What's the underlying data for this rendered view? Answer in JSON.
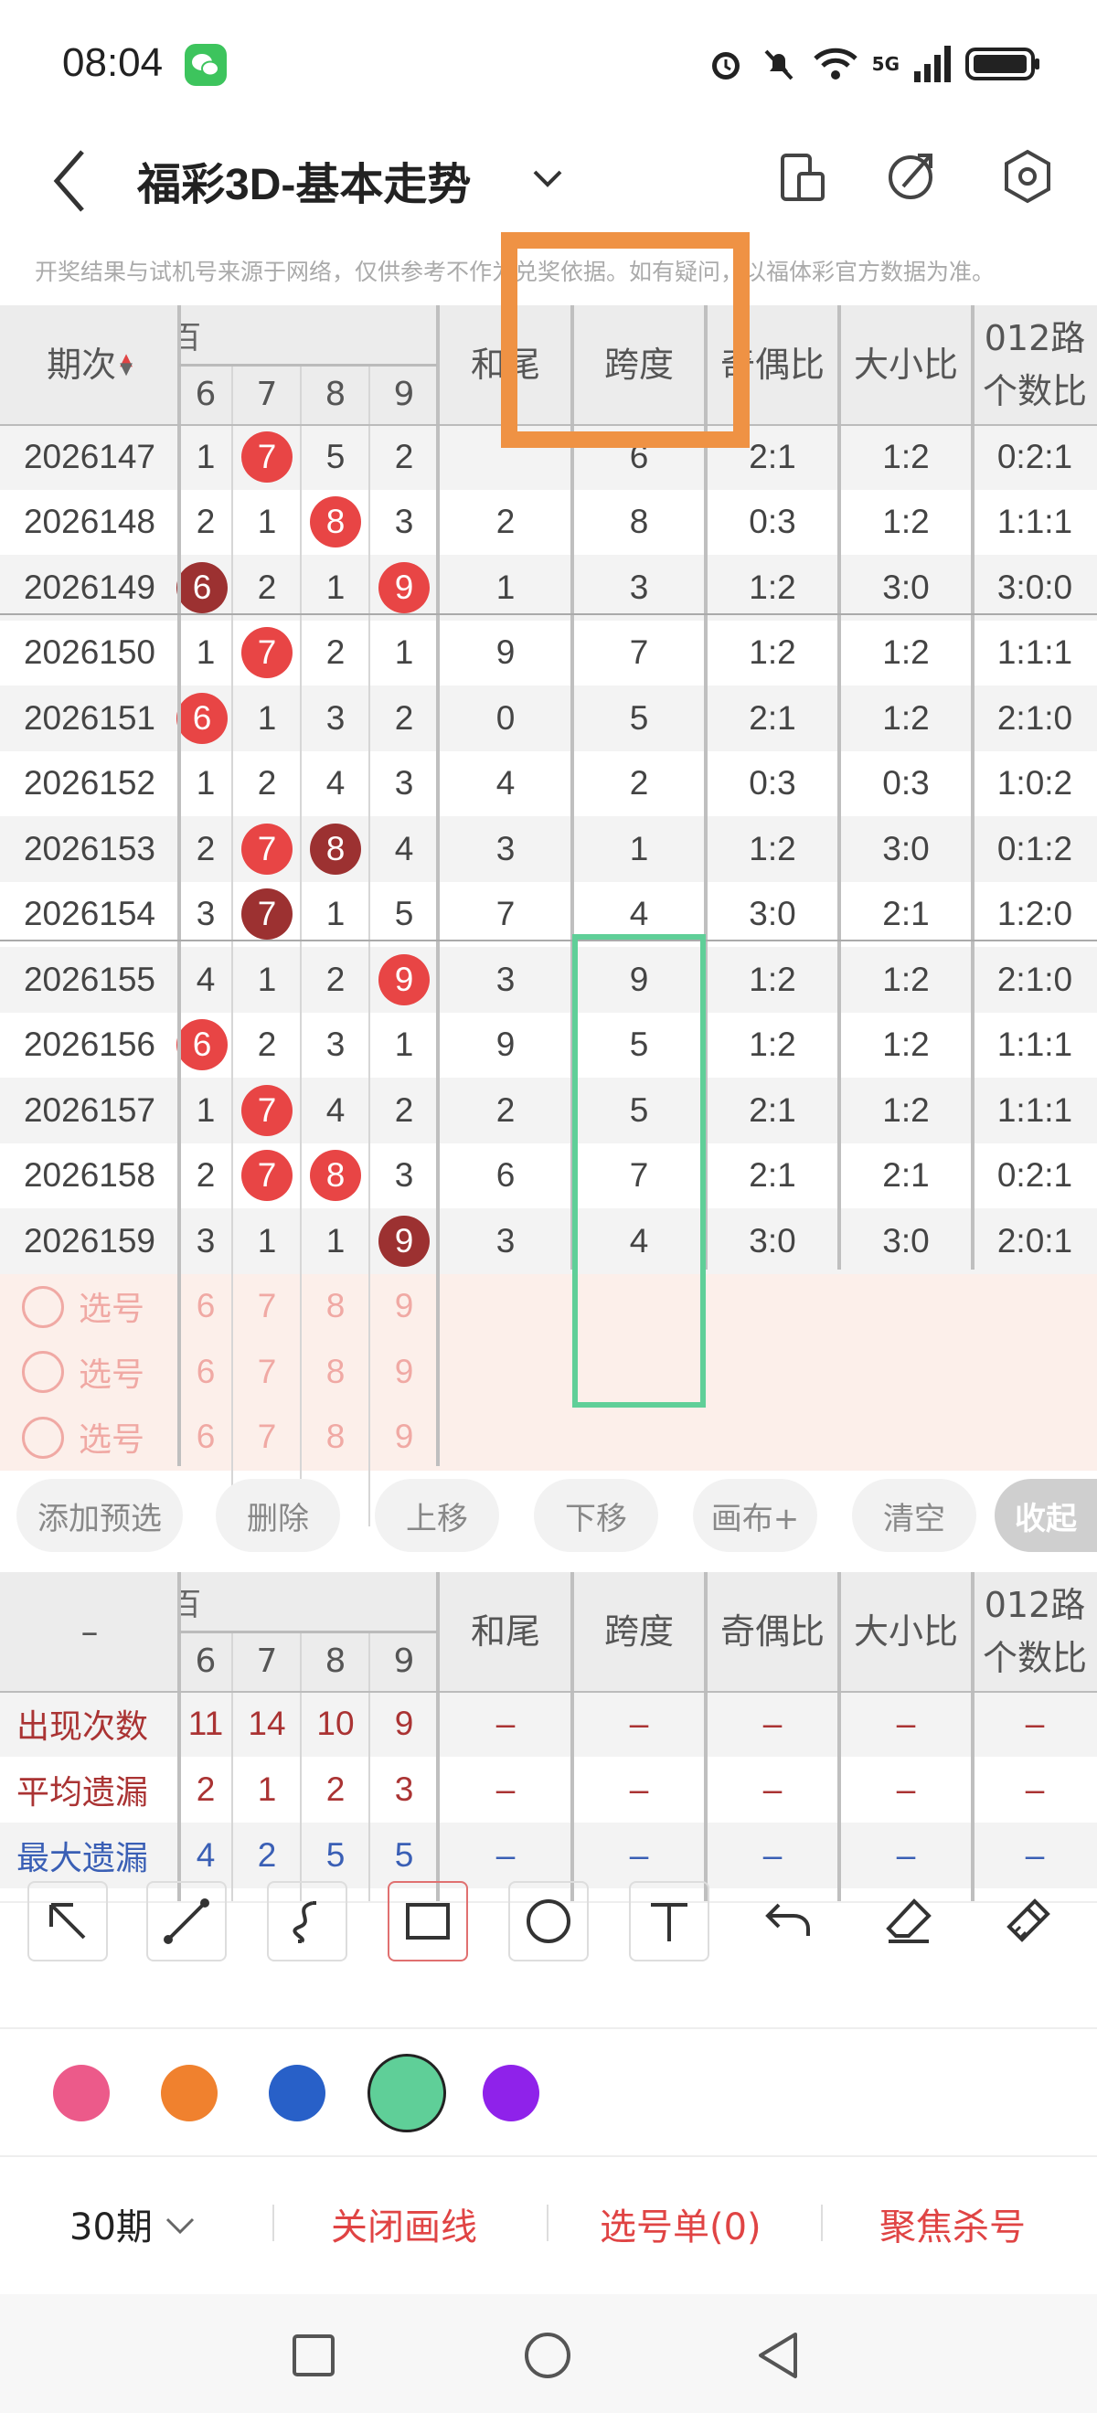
{
  "status_bar": {
    "time": "08:04",
    "network": "5G"
  },
  "header": {
    "title": "福彩3D-基本走势"
  },
  "notice": "开奖结果与试机号来源于网络，仅供参考不作为兑奖依据。如有疑问，以福体彩官方数据为准。",
  "table": {
    "headers": {
      "period": "期次",
      "digit_group": "百",
      "digits": [
        "6",
        "7",
        "8",
        "9"
      ],
      "hewei": "和尾",
      "kuadu": "跨度",
      "jiou": "奇偶比",
      "daxiao": "大小比",
      "lu012": "012路个数比"
    },
    "rows": [
      {
        "period": "2026147",
        "d": [
          "1",
          "7",
          "5",
          "2"
        ],
        "balls": [
          "",
          "red",
          "",
          ""
        ],
        "hewei": "",
        "kuadu": "6",
        "jiou": "2:1",
        "daxiao": "1:2",
        "lu": "0:2:1"
      },
      {
        "period": "2026148",
        "d": [
          "2",
          "1",
          "8",
          "3"
        ],
        "balls": [
          "",
          "",
          "red",
          ""
        ],
        "hewei": "2",
        "kuadu": "8",
        "jiou": "0:3",
        "daxiao": "1:2",
        "lu": "1:1:1"
      },
      {
        "period": "2026149",
        "d": [
          "6",
          "2",
          "1",
          "9"
        ],
        "balls": [
          "dark",
          "",
          "",
          "red"
        ],
        "hewei": "1",
        "kuadu": "3",
        "jiou": "1:2",
        "daxiao": "3:0",
        "lu": "3:0:0"
      },
      {
        "period": "2026150",
        "d": [
          "1",
          "7",
          "2",
          "1"
        ],
        "balls": [
          "",
          "red",
          "",
          ""
        ],
        "hewei": "9",
        "kuadu": "7",
        "jiou": "1:2",
        "daxiao": "1:2",
        "lu": "1:1:1"
      },
      {
        "period": "2026151",
        "d": [
          "6",
          "1",
          "3",
          "2"
        ],
        "balls": [
          "red",
          "",
          "",
          ""
        ],
        "hewei": "0",
        "kuadu": "5",
        "jiou": "2:1",
        "daxiao": "1:2",
        "lu": "2:1:0"
      },
      {
        "period": "2026152",
        "d": [
          "1",
          "2",
          "4",
          "3"
        ],
        "balls": [
          "",
          "",
          "",
          ""
        ],
        "hewei": "4",
        "kuadu": "2",
        "jiou": "0:3",
        "daxiao": "0:3",
        "lu": "1:0:2"
      },
      {
        "period": "2026153",
        "d": [
          "2",
          "7",
          "8",
          "4"
        ],
        "balls": [
          "",
          "red",
          "dark",
          ""
        ],
        "hewei": "3",
        "kuadu": "1",
        "jiou": "1:2",
        "daxiao": "3:0",
        "lu": "0:1:2"
      },
      {
        "period": "2026154",
        "d": [
          "3",
          "7",
          "1",
          "5"
        ],
        "balls": [
          "",
          "dark",
          "",
          ""
        ],
        "hewei": "7",
        "kuadu": "4",
        "jiou": "3:0",
        "daxiao": "2:1",
        "lu": "1:2:0"
      },
      {
        "period": "2026155",
        "d": [
          "4",
          "1",
          "2",
          "9"
        ],
        "balls": [
          "",
          "",
          "",
          "red"
        ],
        "hewei": "3",
        "kuadu": "9",
        "jiou": "1:2",
        "daxiao": "1:2",
        "lu": "2:1:0"
      },
      {
        "period": "2026156",
        "d": [
          "6",
          "2",
          "3",
          "1"
        ],
        "balls": [
          "red",
          "",
          "",
          ""
        ],
        "hewei": "9",
        "kuadu": "5",
        "jiou": "1:2",
        "daxiao": "1:2",
        "lu": "1:1:1"
      },
      {
        "period": "2026157",
        "d": [
          "1",
          "7",
          "4",
          "2"
        ],
        "balls": [
          "",
          "red",
          "",
          ""
        ],
        "hewei": "2",
        "kuadu": "5",
        "jiou": "2:1",
        "daxiao": "1:2",
        "lu": "1:1:1"
      },
      {
        "period": "2026158",
        "d": [
          "2",
          "7",
          "8",
          "3"
        ],
        "balls": [
          "",
          "red",
          "red",
          ""
        ],
        "hewei": "6",
        "kuadu": "7",
        "jiou": "2:1",
        "daxiao": "2:1",
        "lu": "0:2:1"
      },
      {
        "period": "2026159",
        "d": [
          "3",
          "1",
          "1",
          "9"
        ],
        "balls": [
          "",
          "",
          "",
          "dark"
        ],
        "hewei": "3",
        "kuadu": "4",
        "jiou": "3:0",
        "daxiao": "3:0",
        "lu": "2:0:1"
      }
    ],
    "pick_rows": [
      {
        "label": "选号",
        "digits": [
          "6",
          "7",
          "8",
          "9"
        ]
      },
      {
        "label": "选号",
        "digits": [
          "6",
          "7",
          "8",
          "9"
        ]
      },
      {
        "label": "选号",
        "digits": [
          "6",
          "7",
          "8",
          "9"
        ]
      }
    ]
  },
  "actions": {
    "add_pre": "添加预选",
    "delete": "删除",
    "move_up": "上移",
    "move_down": "下移",
    "canvas_plus": "画布+",
    "clear": "清空",
    "collapse": "收起"
  },
  "stats": {
    "header_dash": "–",
    "rows": [
      {
        "label": "出现次数",
        "values": [
          "11",
          "14",
          "10",
          "9"
        ],
        "rest": [
          "–",
          "–",
          "–",
          "–",
          "–"
        ],
        "color": "#a33"
      },
      {
        "label": "平均遗漏",
        "values": [
          "2",
          "1",
          "2",
          "3"
        ],
        "rest": [
          "–",
          "–",
          "–",
          "–",
          "–"
        ],
        "color": "#a33"
      },
      {
        "label": "最大遗漏",
        "values": [
          "4",
          "2",
          "5",
          "5"
        ],
        "rest": [
          "–",
          "–",
          "–",
          "–",
          "–"
        ],
        "color": "#3a5fb5"
      }
    ]
  },
  "drawing_tools": [
    "arrow-tool",
    "line-tool",
    "curve-tool",
    "rectangle-tool",
    "circle-tool",
    "text-tool",
    "undo-tool",
    "eraser-tool",
    "clear-brush-tool"
  ],
  "colors": [
    "#ec5a8a",
    "#f0812e",
    "#2860c8",
    "#5fcf98",
    "#8f22ea"
  ],
  "bottom": {
    "period_select": "30期",
    "close_draw": "关闭画线",
    "pick_list": "选号单(0)",
    "focus_kill": "聚焦杀号"
  }
}
